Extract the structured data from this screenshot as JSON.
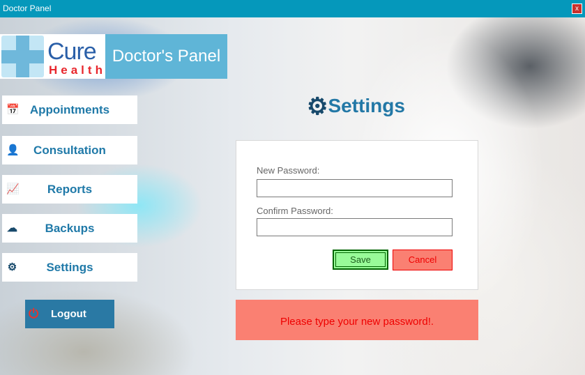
{
  "window": {
    "title": "Doctor Panel",
    "close_label": "x"
  },
  "brand": {
    "logo_text_top": "Cure",
    "logo_text_bottom": "Health",
    "panel_title": "Doctor's Panel"
  },
  "nav": [
    {
      "label": "Appointments",
      "icon": "calendar-check-icon"
    },
    {
      "label": "Consultation",
      "icon": "doctor-icon"
    },
    {
      "label": "Reports",
      "icon": "chart-line-icon"
    },
    {
      "label": "Backups",
      "icon": "cloud-download-icon"
    },
    {
      "label": "Settings",
      "icon": "gear-icon"
    }
  ],
  "logout": {
    "label": "Logout",
    "icon": "power-icon"
  },
  "settings": {
    "title": "Settings",
    "new_password_label": "New Password:",
    "new_password_value": "",
    "confirm_password_label": "Confirm Password:",
    "confirm_password_value": "",
    "save_label": "Save",
    "cancel_label": "Cancel"
  },
  "message": "Please type your new password!.",
  "colors": {
    "titlebar": "#0598bb",
    "accent": "#2378a6",
    "save": "#98fb98",
    "cancel": "#fa8072"
  }
}
